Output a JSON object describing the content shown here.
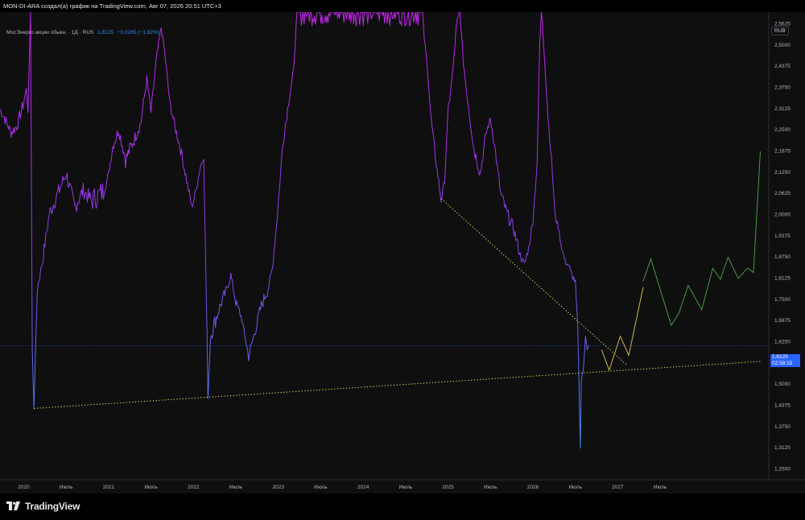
{
  "header": {
    "caption": "MON-DI-ARA создал(а) график на TradingView.com, Авг 07, 2026 20:51 UTC+3"
  },
  "legend": {
    "symbol": "МосЭнерго акции обыкн. · 1Д · RUS",
    "price": "1,6125",
    "change": "−0,0265 (−1,62%)"
  },
  "currency": "RUB",
  "price_badge": {
    "price": "1,6125",
    "countdown": "02:58:15"
  },
  "brand": {
    "name": "TradingView",
    "logo_icon": "tradingview-logo-icon"
  },
  "colors": {
    "background": "#0f0f10",
    "line_high": "#c026e8",
    "line_low": "#3d8cf0",
    "trendline": "#e8e35a",
    "projection_yellow": "#e0cc4a",
    "projection_green": "#4fa64a",
    "price_line": "#2962ff"
  },
  "chart_data": {
    "type": "line",
    "y_axis": {
      "ticks": [
        2.5625,
        2.5,
        2.4375,
        2.375,
        2.3125,
        2.25,
        2.1875,
        2.125,
        2.0625,
        2.0,
        1.9375,
        1.875,
        1.8125,
        1.75,
        1.6875,
        1.625,
        1.5625,
        1.5,
        1.4375,
        1.375,
        1.3125,
        1.25
      ],
      "tick_labels": [
        "2,5625",
        "2,5000",
        "2,4375",
        "2,3750",
        "2,3125",
        "2,2500",
        "2,1875",
        "2,1250",
        "2,0625",
        "2,0000",
        "1,9375",
        "1,8750",
        "1,8125",
        "1,7500",
        "1,6875",
        "1,6250",
        "1,5625",
        "1,5000",
        "1,4375",
        "1,3750",
        "1,3125",
        "1,2500"
      ],
      "range": [
        1.2167,
        2.5958
      ]
    },
    "x_axis": {
      "range": [
        2019.72,
        2028.78
      ],
      "ticks": [
        {
          "t": 2020.0,
          "label": "2020"
        },
        {
          "t": 2020.5,
          "label": "Июль"
        },
        {
          "t": 2021.0,
          "label": "2021"
        },
        {
          "t": 2021.5,
          "label": "Июль"
        },
        {
          "t": 2022.0,
          "label": "2022"
        },
        {
          "t": 2022.5,
          "label": "Июль"
        },
        {
          "t": 2023.0,
          "label": "2023"
        },
        {
          "t": 2023.5,
          "label": "Июль"
        },
        {
          "t": 2024.0,
          "label": "2024"
        },
        {
          "t": 2024.5,
          "label": "Июль"
        },
        {
          "t": 2025.0,
          "label": "2025"
        },
        {
          "t": 2025.5,
          "label": "Июль"
        },
        {
          "t": 2026.0,
          "label": "2026"
        },
        {
          "t": 2026.5,
          "label": "Июль"
        },
        {
          "t": 2027.0,
          "label": "2027"
        },
        {
          "t": 2027.5,
          "label": "Июль"
        }
      ]
    },
    "series": [
      {
        "kind": "price",
        "points": [
          [
            2019.72,
            2.31
          ],
          [
            2019.78,
            2.28
          ],
          [
            2019.85,
            2.24
          ],
          [
            2019.92,
            2.26
          ],
          [
            2020.0,
            2.33
          ],
          [
            2020.03,
            2.37
          ],
          [
            2020.05,
            2.3
          ],
          [
            2020.07,
            2.5
          ],
          [
            2020.08,
            2.6
          ],
          [
            2020.1,
            1.6
          ],
          [
            2020.12,
            1.43
          ],
          [
            2020.16,
            1.78
          ],
          [
            2020.22,
            1.86
          ],
          [
            2020.3,
            2.0
          ],
          [
            2020.4,
            2.06
          ],
          [
            2020.5,
            2.12
          ],
          [
            2020.6,
            2.02
          ],
          [
            2020.7,
            2.07
          ],
          [
            2020.8,
            2.04
          ],
          [
            2020.95,
            2.07
          ],
          [
            2021.0,
            2.12
          ],
          [
            2021.05,
            2.2
          ],
          [
            2021.12,
            2.25
          ],
          [
            2021.2,
            2.16
          ],
          [
            2021.3,
            2.22
          ],
          [
            2021.38,
            2.27
          ],
          [
            2021.45,
            2.4
          ],
          [
            2021.5,
            2.3
          ],
          [
            2021.56,
            2.45
          ],
          [
            2021.62,
            2.55
          ],
          [
            2021.66,
            2.48
          ],
          [
            2021.72,
            2.33
          ],
          [
            2021.78,
            2.26
          ],
          [
            2021.85,
            2.19
          ],
          [
            2021.92,
            2.1
          ],
          [
            2021.98,
            2.02
          ],
          [
            2022.03,
            2.07
          ],
          [
            2022.08,
            2.14
          ],
          [
            2022.12,
            2.17
          ],
          [
            2022.16,
            1.65
          ],
          [
            2022.17,
            1.45
          ],
          [
            2022.2,
            1.64
          ],
          [
            2022.3,
            1.72
          ],
          [
            2022.38,
            1.77
          ],
          [
            2022.44,
            1.82
          ],
          [
            2022.5,
            1.74
          ],
          [
            2022.56,
            1.7
          ],
          [
            2022.6,
            1.65
          ],
          [
            2022.65,
            1.58
          ],
          [
            2022.72,
            1.65
          ],
          [
            2022.8,
            1.73
          ],
          [
            2022.88,
            1.78
          ],
          [
            2022.93,
            1.84
          ],
          [
            2022.99,
            2.0
          ],
          [
            2023.05,
            2.2
          ],
          [
            2023.12,
            2.33
          ],
          [
            2023.18,
            2.42
          ],
          [
            2023.22,
            2.6
          ],
          [
            2024.7,
            2.6
          ],
          [
            2024.72,
            2.52
          ],
          [
            2024.76,
            2.42
          ],
          [
            2024.8,
            2.28
          ],
          [
            2024.86,
            2.15
          ],
          [
            2024.92,
            2.04
          ],
          [
            2024.96,
            2.1
          ],
          [
            2025.0,
            2.3
          ],
          [
            2025.06,
            2.43
          ],
          [
            2025.1,
            2.56
          ],
          [
            2025.14,
            2.6
          ],
          [
            2025.18,
            2.45
          ],
          [
            2025.24,
            2.32
          ],
          [
            2025.3,
            2.2
          ],
          [
            2025.38,
            2.12
          ],
          [
            2025.45,
            2.24
          ],
          [
            2025.5,
            2.28
          ],
          [
            2025.55,
            2.2
          ],
          [
            2025.62,
            2.06
          ],
          [
            2025.7,
            2.0
          ],
          [
            2025.78,
            1.95
          ],
          [
            2025.85,
            1.88
          ],
          [
            2025.9,
            1.85
          ],
          [
            2025.95,
            1.9
          ],
          [
            2026.0,
            1.98
          ],
          [
            2026.05,
            2.15
          ],
          [
            2026.08,
            2.5
          ],
          [
            2026.1,
            2.6
          ],
          [
            2026.14,
            2.45
          ],
          [
            2026.18,
            2.28
          ],
          [
            2026.22,
            2.16
          ],
          [
            2026.26,
            2.0
          ],
          [
            2026.3,
            1.96
          ],
          [
            2026.34,
            1.9
          ],
          [
            2026.38,
            1.86
          ],
          [
            2026.42,
            1.85
          ],
          [
            2026.46,
            1.82
          ],
          [
            2026.5,
            1.8
          ],
          [
            2026.53,
            1.66
          ],
          [
            2026.55,
            1.42
          ],
          [
            2026.56,
            1.31
          ],
          [
            2026.57,
            1.5
          ],
          [
            2026.6,
            1.56
          ],
          [
            2026.62,
            1.64
          ],
          [
            2026.64,
            1.6
          ],
          [
            2026.66,
            1.6125
          ]
        ]
      },
      {
        "kind": "trendline",
        "points": [
          [
            2020.12,
            1.427
          ],
          [
            2028.7,
            1.566
          ]
        ]
      },
      {
        "kind": "trendline",
        "points": [
          [
            2024.92,
            2.045
          ],
          [
            2027.1,
            1.557
          ]
        ]
      },
      {
        "kind": "projection",
        "points": [
          [
            2026.81,
            1.6
          ],
          [
            2026.9,
            1.54
          ],
          [
            2027.03,
            1.64
          ],
          [
            2027.13,
            1.584
          ],
          [
            2027.3,
            1.785
          ]
        ]
      },
      {
        "kind": "projection",
        "points": [
          [
            2027.3,
            1.802
          ],
          [
            2027.39,
            1.868
          ],
          [
            2027.63,
            1.672
          ],
          [
            2027.72,
            1.708
          ],
          [
            2027.83,
            1.79
          ],
          [
            2027.99,
            1.718
          ],
          [
            2028.12,
            1.84
          ],
          [
            2028.21,
            1.808
          ],
          [
            2028.3,
            1.873
          ],
          [
            2028.42,
            1.81
          ],
          [
            2028.53,
            1.841
          ],
          [
            2028.6,
            1.828
          ],
          [
            2028.68,
            2.185
          ]
        ]
      }
    ],
    "current_price": 1.6125
  }
}
